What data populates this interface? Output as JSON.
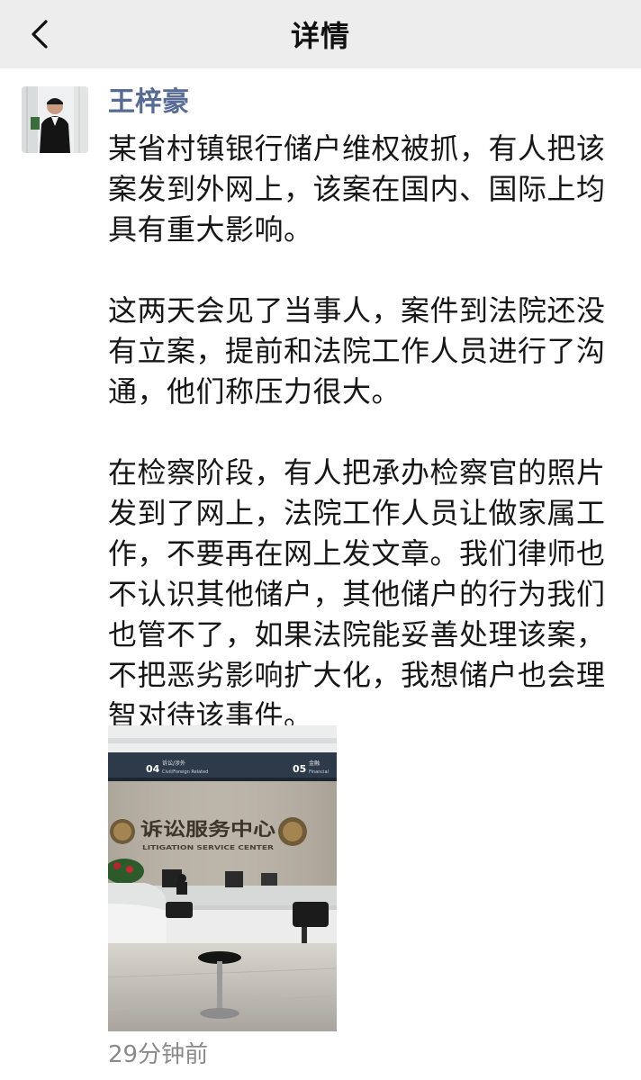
{
  "navbar": {
    "title": "详情",
    "back_icon": "chevron-left-icon"
  },
  "post": {
    "author": "王梓豪",
    "avatar_icon": "user-avatar",
    "text": "某省村镇银行储户维权被抓，有人把该案发到外网上，该案在国内、国际上均具有重大影响。\n\n这两天会见了当事人，案件到法院还没有立案，提前和法院工作人员进行了沟通，他们称压力很大。\n\n在检察阶段，有人把承办检察官的照片发到了网上，法院工作人员让做家属工作，不要再在网上发文章。我们律师也不认识其他储户，其他储户的行为我们也管不了，如果法院能妥善处理该案，不把恶劣影响扩大化，我想储户也会理智对待该事件。",
    "time": "29分钟前",
    "photo": {
      "sign_left_number": "04",
      "sign_left_cn": "诉讼/涉外",
      "sign_left_en": "Civil/Foreign Related",
      "sign_right_number": "05",
      "sign_right_cn": "金融",
      "sign_right_en": "Financial",
      "wall_cn": "诉讼服务中心",
      "wall_en": "LITIGATION SERVICE CENTER"
    }
  },
  "colors": {
    "navbar_bg": "#ededed",
    "author_name": "#576b95",
    "timestamp": "#8a8a8a"
  }
}
